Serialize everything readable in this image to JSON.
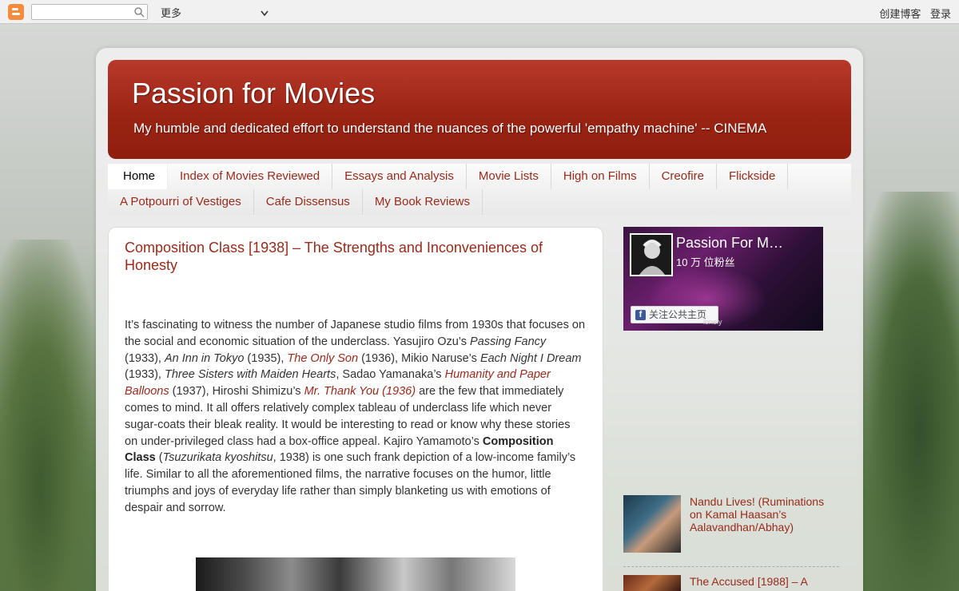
{
  "navbar": {
    "more_label": "更多",
    "create_blog": "创建博客",
    "login": "登录"
  },
  "header": {
    "title": "Passion for Movies",
    "description": "My humble and dedicated effort to understand the nuances of the powerful 'empathy machine' -- CINEMA"
  },
  "tabs": {
    "row1": [
      {
        "label": "Home"
      },
      {
        "label": "Index of Movies Reviewed"
      },
      {
        "label": "Essays and Analysis"
      },
      {
        "label": "Movie Lists"
      },
      {
        "label": "High on Films"
      },
      {
        "label": "Creofire"
      },
      {
        "label": "Flickside"
      }
    ],
    "row2": [
      {
        "label": "A Potpourri of Vestiges"
      },
      {
        "label": "Cafe Dissensus"
      },
      {
        "label": "My Book Reviews"
      }
    ]
  },
  "post": {
    "title": "Composition Class [1938] – The Strengths and Inconveniences of Honesty",
    "p": [
      "It’s fascinating to witness the number of Japanese studio films from 1930s that focuses on the social and economic situation of the underclass. Yasujiro Ozu’s ",
      "Passing Fancy",
      " (1933), ",
      "An Inn in Tokyo",
      " (1935), ",
      "The Only Son",
      " (1936), Mikio Naruse’s ",
      "Each Night I Dream",
      " (1933), ",
      "Three Sisters with Maiden Hearts",
      ", Sadao Yamanaka’s ",
      "Humanity and Paper Balloons",
      " (1937), Hiroshi Shimizu’s ",
      "Mr. Thank You",
      " (1936)",
      " are the few that immediately comes to mind. It all offers relatively complex tableau of underclass life which never sugar-coats their bleak reality. It would be interesting to read or know why these stories on under-privileged class had a box-office appeal. Kajiro Yamamoto’s ",
      "Composition Class",
      " (",
      "Tsuzurikata kyoshitsu",
      ", 1938) is one such frank depiction of a low-income family’s life. Similar to all the aforementioned films, the narrative focuses on the humor, little triumphs and joys of everyday life rather than simply blanketing us with emotions of despair and sorrow."
    ]
  },
  "fb_widget": {
    "page_name": "Passion For M…",
    "fans": "10 万 位粉丝",
    "follow_label": "关注公共主页",
    "caption": "lonely"
  },
  "related": [
    {
      "title": "Nandu Lives! (Ruminations on Kamal Haasan’s Aalavandhan/Abhay)"
    },
    {
      "title": "The Accused [1988] – A"
    }
  ],
  "colors": {
    "accent": "#9a2a1a",
    "header_bg": "#9a2414"
  }
}
